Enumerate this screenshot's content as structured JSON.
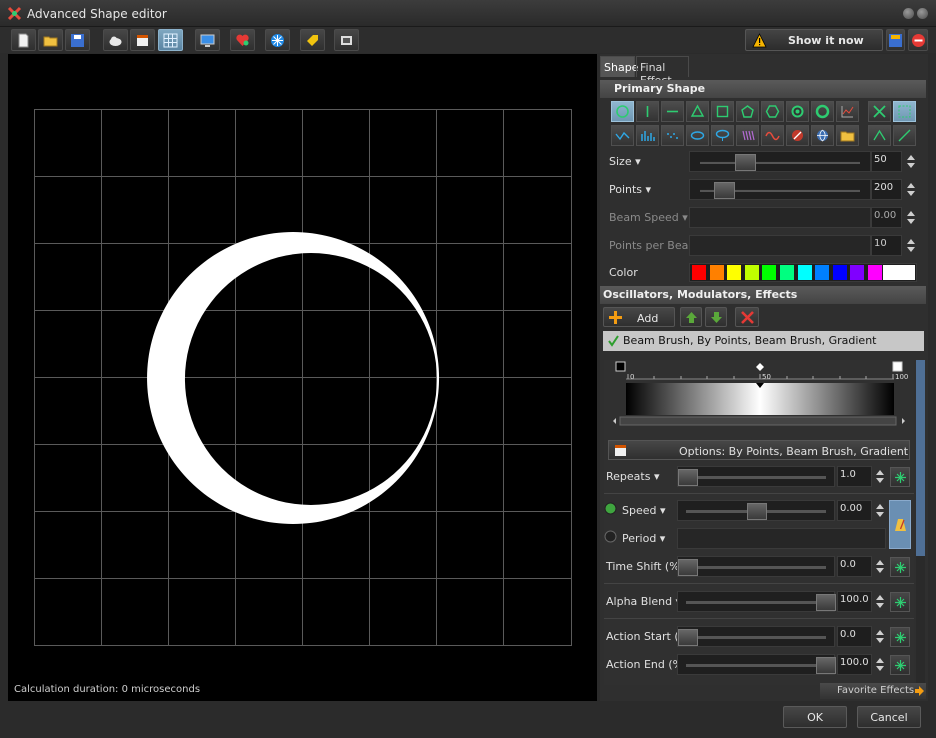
{
  "window": {
    "title": "Advanced Shape editor"
  },
  "toolbar": {
    "buttons": [
      "new-file-icon",
      "open-folder-icon",
      "save-disk-icon",
      "cloud-icon",
      "clapper-icon",
      "grid-icon",
      "monitor-icon",
      "heart-icon",
      "snowflake-icon",
      "tag-icon",
      "film-icon"
    ],
    "show_label": "Show it now"
  },
  "canvas": {
    "status": "Calculation duration: 0 microseconds"
  },
  "tabs": [
    "Shape",
    "Final Effect"
  ],
  "primary_shape": {
    "header": "Primary Shape",
    "size_label": "Size",
    "size_value": "50",
    "size_level": 0.28,
    "points_label": "Points",
    "points_value": "200",
    "points_level": 0.15,
    "beam_speed_label": "Beam Speed",
    "beam_speed_value": "0.00",
    "ppb_label": "Points per Beam",
    "ppb_value": "10",
    "color_label": "Color",
    "colors": [
      "#ff0000",
      "#ff8000",
      "#ffff00",
      "#c0ff00",
      "#00ff00",
      "#00ff80",
      "#00ffff",
      "#0080ff",
      "#0000ff",
      "#8000ff",
      "#ff00ff",
      "#ff0080",
      "#ffffff"
    ]
  },
  "oscillators": {
    "header": "Oscillators, Modulators, Effects",
    "add_label": "Add",
    "effect_item": "Beam Brush, By Points, Beam Brush, Gradient",
    "gradient_ticks": [
      "0",
      "50",
      "100"
    ],
    "options_label": "Options: By Points, Beam Brush, Gradient",
    "repeats_label": "Repeats",
    "repeats_value": "1.0",
    "repeats_level": 0.0,
    "speed_label": "Speed",
    "speed_value": "0.00",
    "speed_level": 0.5,
    "period_label": "Period",
    "time_shift_label": "Time Shift (%)",
    "time_shift_value": "0.0",
    "time_shift_level": 0.0,
    "alpha_label": "Alpha Blend",
    "alpha_value": "100.0",
    "alpha_level": 1.0,
    "action_start_label": "Action Start (%)",
    "action_start_value": "0.0",
    "action_start_level": 0.0,
    "action_end_label": "Action End (%)",
    "action_end_value": "100.0",
    "action_end_level": 1.0
  },
  "favorites_label": "Favorite Effects",
  "dialog": {
    "ok": "OK",
    "cancel": "Cancel"
  }
}
